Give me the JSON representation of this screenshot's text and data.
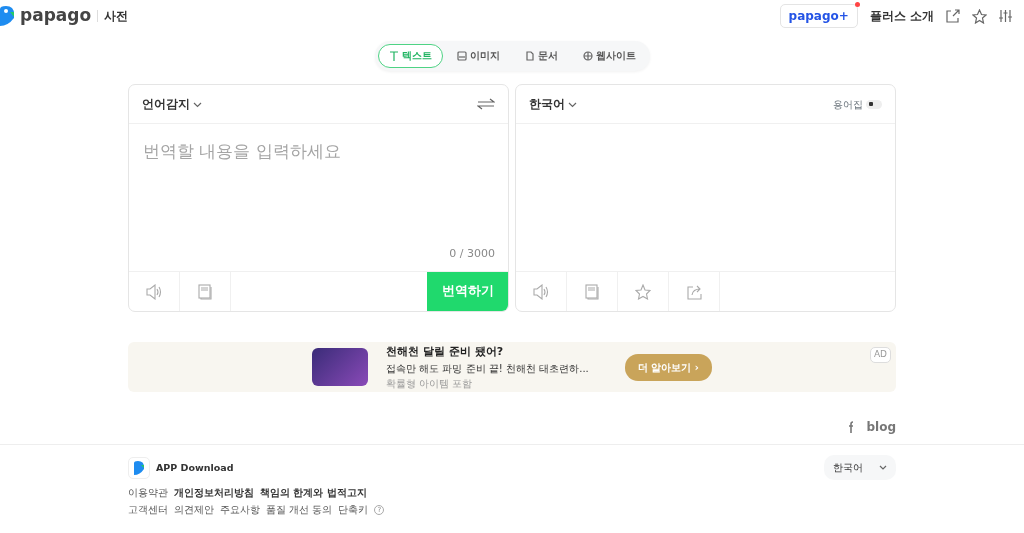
{
  "header": {
    "logo_text": "papago",
    "section": "사전",
    "plus_badge": "papago+",
    "plus_new": true,
    "plus_intro": "플러스 소개"
  },
  "mode_tabs": [
    {
      "label": "텍스트",
      "kind": "text",
      "selected": true
    },
    {
      "label": "이미지",
      "kind": "image",
      "selected": false
    },
    {
      "label": "문서",
      "kind": "document",
      "selected": false
    },
    {
      "label": "웹사이트",
      "kind": "website",
      "selected": false
    }
  ],
  "source": {
    "language": "언어감지",
    "placeholder": "번역할 내용을 입력하세요",
    "counter": "0 / 3000",
    "translate_button": "번역하기"
  },
  "target": {
    "language": "한국어",
    "glossary_label": "용어집",
    "glossary_on": false
  },
  "ad": {
    "title": "천해천 달릴 준비 됐어?",
    "description": "접속만 해도 파밍 준비 끝! 천해천 태초련하...",
    "note": "확률형 아이템 포함",
    "button": "더 알아보기 ›",
    "badge": "AD"
  },
  "social": {
    "blog": "blog"
  },
  "footer": {
    "app_download": "APP Download",
    "language": "한국어",
    "links_row_1": [
      {
        "label": "이용약관",
        "bold": false
      },
      {
        "label": "개인정보처리방침",
        "bold": true
      },
      {
        "label": "책임의 한계와 법적고지",
        "bold": true
      }
    ],
    "links_row_2": [
      {
        "label": "고객센터",
        "bold": false
      },
      {
        "label": "의견제안",
        "bold": false
      },
      {
        "label": "주요사항",
        "bold": false
      },
      {
        "label": "품질 개선 동의",
        "bold": false
      },
      {
        "label": "단축키",
        "bold": false
      }
    ],
    "help": "?"
  }
}
